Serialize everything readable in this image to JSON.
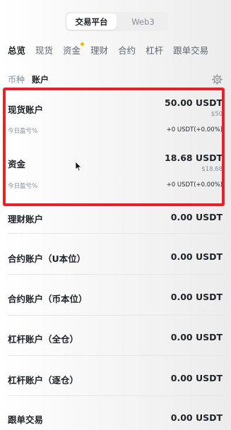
{
  "platform_switch": {
    "options": [
      "交易平台",
      "Web3"
    ],
    "active": 0
  },
  "main_tabs": [
    "总览",
    "现货",
    "资金",
    "理财",
    "合约",
    "杠杆",
    "跟单交易"
  ],
  "main_tabs_active": 0,
  "sub_tabs": [
    "币种",
    "账户"
  ],
  "sub_tabs_active": 1,
  "accounts": [
    {
      "name": "现货账户",
      "amount": "50.00 USDT",
      "fiat": "$50",
      "pnl_label": "今日盈亏%",
      "pnl": "+0 USDT(+0.00%)"
    },
    {
      "name": "资金",
      "amount": "18.68 USDT",
      "fiat": "$18.68",
      "pnl_label": "今日盈亏%",
      "pnl": "+0 USDT(+0.00%)"
    },
    {
      "name": "理财账户",
      "amount": "0.00 USDT"
    },
    {
      "name": "合约账户（U本位）",
      "amount": "0.00 USDT"
    },
    {
      "name": "合约账户（币本位）",
      "amount": "0.00 USDT"
    },
    {
      "name": "杠杆账户（全仓）",
      "amount": "0.00 USDT"
    },
    {
      "name": "杠杆账户（逐仓）",
      "amount": "0.00 USDT"
    },
    {
      "name": "跟单交易",
      "amount": "0.00 USDT"
    }
  ],
  "colors": {
    "accent": "#f0b90b",
    "highlight": "#e8202a",
    "text": "#1e2329",
    "muted": "#848e9c"
  },
  "icons": {
    "settings": "gear-icon",
    "cursor": "mouse-pointer-icon"
  }
}
